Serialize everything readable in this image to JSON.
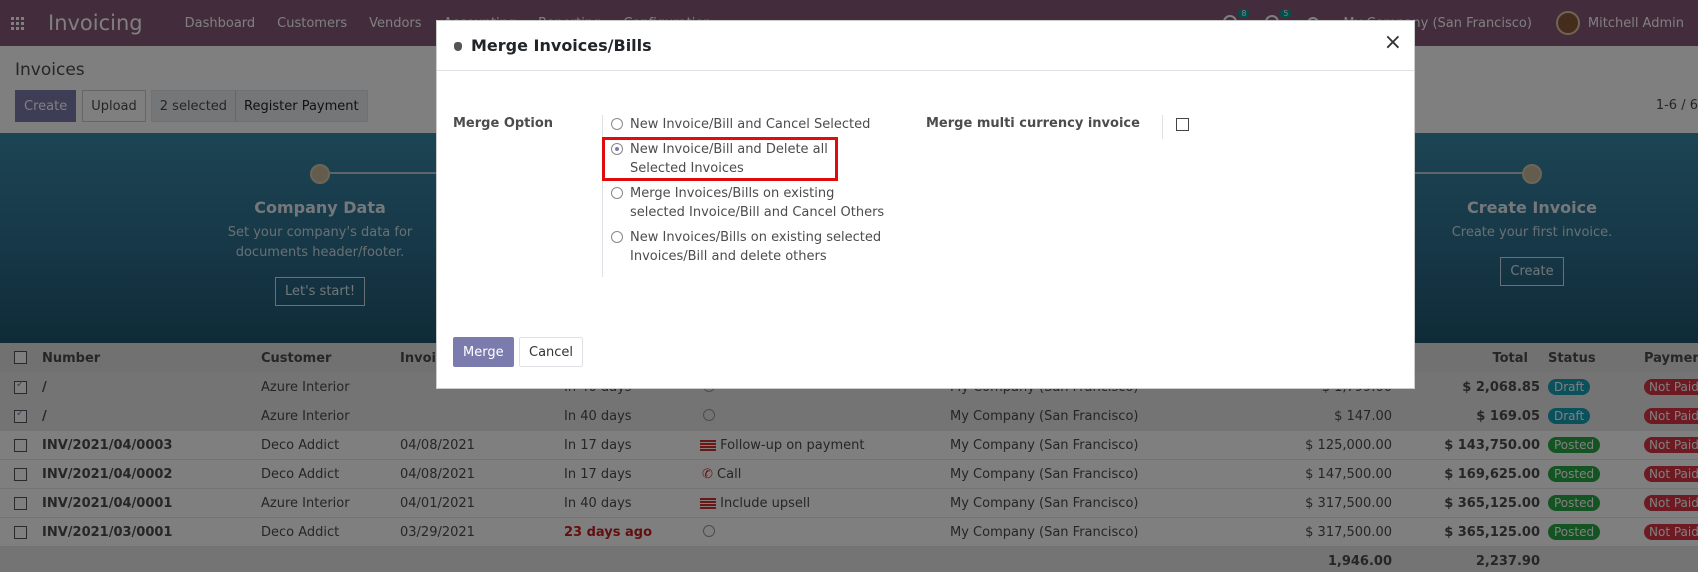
{
  "navbar": {
    "app_name": "Invoicing",
    "menu": [
      "Dashboard",
      "Customers",
      "Vendors",
      "Accounting",
      "Reporting",
      "Configuration"
    ],
    "chat_count": "8",
    "activity_count": "5",
    "company": "My Company (San Francisco)",
    "user": "Mitchell Admin"
  },
  "control": {
    "breadcrumb": "Invoices",
    "create_label": "Create",
    "upload_label": "Upload",
    "selected_label": "2 selected",
    "register_payment_label": "Register Payment",
    "pager": "1-6 / 6"
  },
  "onboarding": {
    "step1": {
      "title": "Company Data",
      "desc1": "Set your company's data for",
      "desc2": "documents header/footer.",
      "button": "Let's start!"
    },
    "step2": {
      "title": "Create Invoice",
      "desc1": "Create your first invoice.",
      "button": "Create"
    }
  },
  "table": {
    "headers": {
      "number": "Number",
      "customer": "Customer",
      "invoice_date": "Invoice Date",
      "total": "Total",
      "status": "Status",
      "payment": "Payment Status"
    },
    "rows": [
      {
        "number": "/",
        "customer": "Azure Interior",
        "invoice_date": "",
        "due": "In 40 days",
        "activity": "",
        "company": "My Company (San Francisco)",
        "untaxed": "$ 1,799.00",
        "total": "$ 2,068.85",
        "status": "Draft",
        "payment": "Not Paid"
      },
      {
        "number": "/",
        "customer": "Azure Interior",
        "invoice_date": "",
        "due": "In 40 days",
        "activity": "",
        "company": "My Company (San Francisco)",
        "untaxed": "$ 147.00",
        "total": "$ 169.05",
        "status": "Draft",
        "payment": "Not Paid"
      },
      {
        "number": "INV/2021/04/0003",
        "customer": "Deco Addict",
        "invoice_date": "04/08/2021",
        "due": "In 17 days",
        "activity": "Follow-up on payment",
        "company": "My Company (San Francisco)",
        "untaxed": "$ 125,000.00",
        "total": "$ 143,750.00",
        "status": "Posted",
        "payment": "Not Paid"
      },
      {
        "number": "INV/2021/04/0002",
        "customer": "Deco Addict",
        "invoice_date": "04/08/2021",
        "due": "In 17 days",
        "activity": "Call",
        "company": "My Company (San Francisco)",
        "untaxed": "$ 147,500.00",
        "total": "$ 169,625.00",
        "status": "Posted",
        "payment": "Not Paid"
      },
      {
        "number": "INV/2021/04/0001",
        "customer": "Azure Interior",
        "invoice_date": "04/01/2021",
        "due": "In 40 days",
        "activity": "Include upsell",
        "company": "My Company (San Francisco)",
        "untaxed": "$ 317,500.00",
        "total": "$ 365,125.00",
        "status": "Posted",
        "payment": "Not Paid"
      },
      {
        "number": "INV/2021/03/0001",
        "customer": "Deco Addict",
        "invoice_date": "03/29/2021",
        "due": "23 days ago",
        "activity": "",
        "company": "My Company (San Francisco)",
        "untaxed": "$ 317,500.00",
        "total": "$ 365,125.00",
        "status": "Posted",
        "payment": "Not Paid"
      }
    ],
    "footer": {
      "untaxed_sum": "1,946.00",
      "total_sum": "2,237.90"
    }
  },
  "modal": {
    "title": "Merge Invoices/Bills",
    "close_symbol": "×",
    "merge_option_label": "Merge Option",
    "options": [
      {
        "line1": "New Invoice/Bill and Cancel Selected",
        "line2": ""
      },
      {
        "line1": "New Invoice/Bill and Delete all",
        "line2": "Selected Invoices"
      },
      {
        "line1": "Merge Invoices/Bills on existing",
        "line2": "selected Invoice/Bill and Cancel Others"
      },
      {
        "line1": "New Invoices/Bills on existing selected",
        "line2": "Invoices/Bill and delete others"
      }
    ],
    "selected_option_index": 1,
    "multi_currency_label": "Merge multi currency invoice",
    "multi_currency_checked": false,
    "merge_button": "Merge",
    "cancel_button": "Cancel"
  },
  "colors": {
    "brand": "#875a7b",
    "primary_button": "#7c7bad",
    "highlight_border": "#e00b0b",
    "draft": "#17a2b8",
    "posted": "#28a745",
    "not_paid": "#dc3545"
  }
}
